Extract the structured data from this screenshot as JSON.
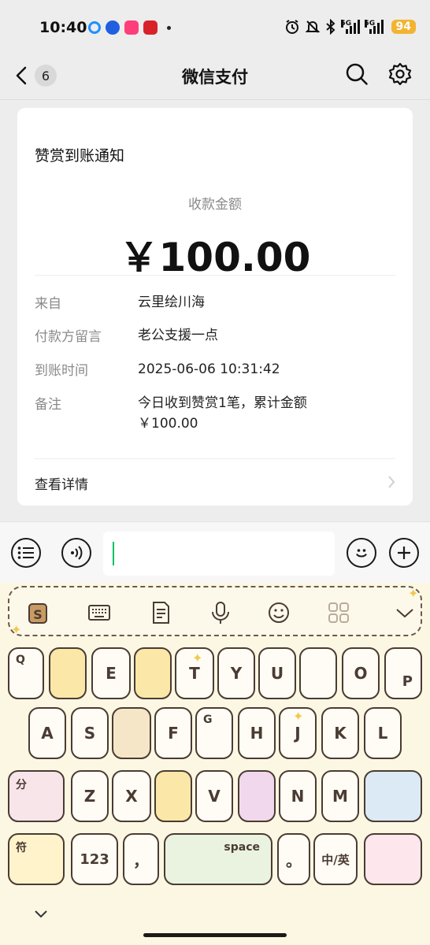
{
  "status_bar": {
    "time": "10:40",
    "network_label_1": "5G",
    "network_label_2": "5G",
    "battery": "94"
  },
  "header": {
    "unread_count": "6",
    "title": "微信支付"
  },
  "card": {
    "title": "赞赏到账通知",
    "amount_label": "收款金额",
    "amount": "￥100.00",
    "rows": [
      {
        "key": "来自",
        "value": "云里绘川海"
      },
      {
        "key": "付款方留言",
        "value": "老公支援一点"
      },
      {
        "key": "到账时间",
        "value": "2025-06-06 10:31:42"
      },
      {
        "key": "备注",
        "value": "今日收到赞赏1笔，累计金额 ￥100.00"
      }
    ],
    "details_link": "查看详情"
  },
  "keyboard": {
    "row1": [
      "Q",
      "E",
      "T",
      "Y",
      "U",
      "O",
      "P"
    ],
    "row2": [
      "A",
      "S",
      "F",
      "G",
      "H",
      "J",
      "K",
      "L"
    ],
    "row3": [
      "Z",
      "X",
      "V",
      "N",
      "M"
    ],
    "row3_left_label": "分",
    "row4_symbol_label": "符",
    "row4_numbers": "123",
    "row4_comma": "，",
    "row4_space": "space",
    "row4_period": "。",
    "row4_lang": "中/英"
  }
}
